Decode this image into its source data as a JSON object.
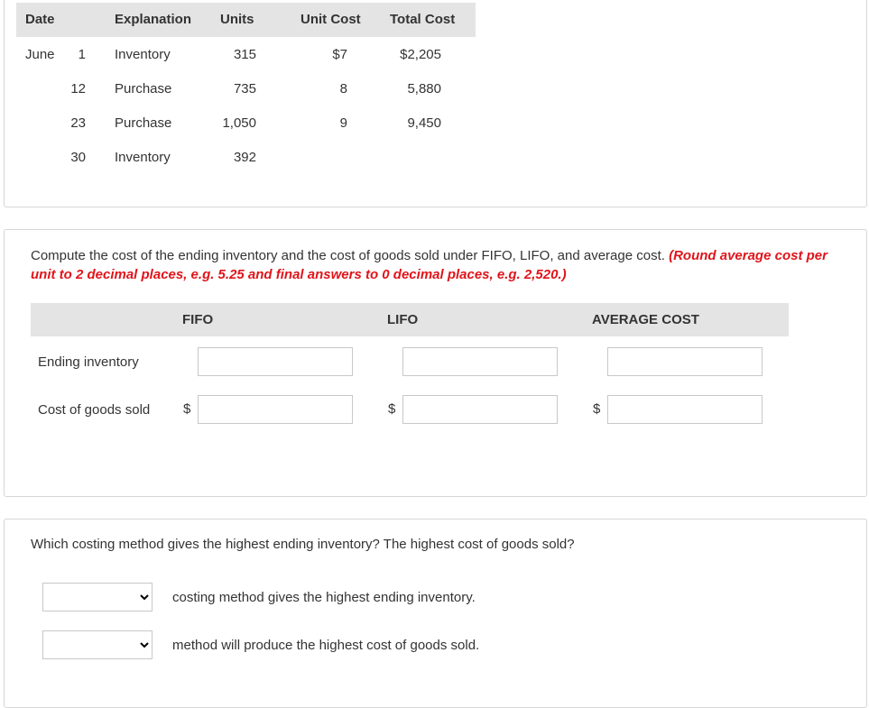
{
  "table": {
    "headers": [
      "Date",
      "Explanation",
      "Units",
      "Unit Cost",
      "Total Cost"
    ],
    "rows": [
      {
        "month": "June",
        "day": "1",
        "explanation": "Inventory",
        "units": "315",
        "unit_cost": "$7",
        "total_cost": "$2,205"
      },
      {
        "month": "",
        "day": "12",
        "explanation": "Purchase",
        "units": "735",
        "unit_cost": "8",
        "total_cost": "5,880"
      },
      {
        "month": "",
        "day": "23",
        "explanation": "Purchase",
        "units": "1,050",
        "unit_cost": "9",
        "total_cost": "9,450"
      },
      {
        "month": "",
        "day": "30",
        "explanation": "Inventory",
        "units": "392",
        "unit_cost": "",
        "total_cost": ""
      }
    ]
  },
  "compute": {
    "instruction": "Compute the cost of the ending inventory and the cost of goods sold under FIFO, LIFO, and average cost.",
    "note_line1": "(Round average cost per",
    "note_line2": "unit to 2 decimal places, e.g. 5.25 and final answers to 0 decimal places, e.g. 2,520.)",
    "columns": [
      "FIFO",
      "LIFO",
      "AVERAGE COST"
    ],
    "row_labels": [
      "Ending inventory",
      "Cost of goods sold"
    ],
    "currency": "$",
    "values": {
      "ending": [
        "",
        "",
        ""
      ],
      "cogs": [
        "",
        "",
        ""
      ]
    }
  },
  "question": {
    "text": "Which costing method gives the highest ending inventory? The highest cost of goods sold?",
    "select1_value": "",
    "select1_suffix": "costing method gives the highest ending inventory.",
    "select2_value": "",
    "select2_suffix": "method will produce the highest cost of goods sold."
  }
}
